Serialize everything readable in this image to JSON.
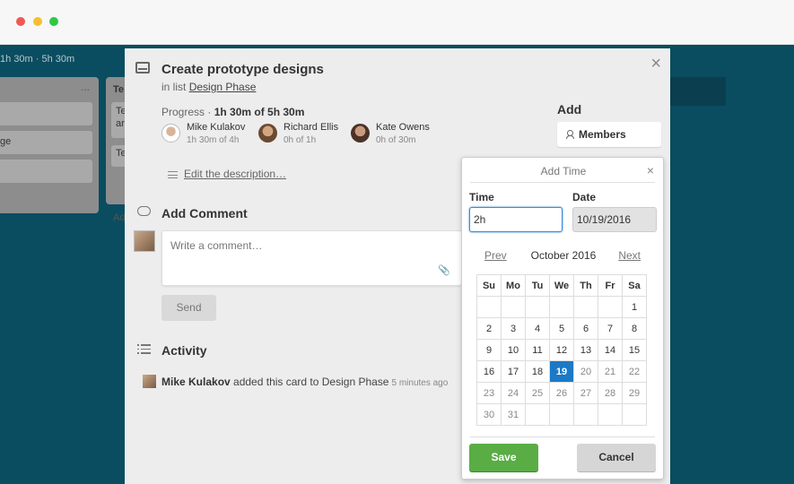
{
  "board": {
    "meta": "1h 30m · 5h 30m",
    "list1_cards": [
      "",
      "ge",
      ""
    ],
    "list1_more": "...",
    "list2_header": "Te",
    "list2_cards": [
      "Te\nar",
      "Te"
    ],
    "list2_add": "Ad"
  },
  "card": {
    "title": "Create prototype designs",
    "in_list_prefix": "in list",
    "list_name": "Design Phase",
    "progress_label": "Progress · ",
    "progress_value": "1h 30m of 5h 30m",
    "members": [
      {
        "name": "Mike Kulakov",
        "time": "1h 30m of 4h",
        "color": "#f2f2f2"
      },
      {
        "name": "Richard Ellis",
        "time": "0h of 1h",
        "color": "#8a5a3a"
      },
      {
        "name": "Kate Owens",
        "time": "0h of 30m",
        "color": "#5a3f33"
      }
    ],
    "edit_description": "Edit the description…",
    "add_comment_title": "Add Comment",
    "comment_placeholder": "Write a comment…",
    "send_label": "Send",
    "activity_title": "Activity",
    "activity": {
      "user": "Mike Kulakov",
      "text": " added this card to Design Phase",
      "ago": "5 minutes ago"
    },
    "close": "×"
  },
  "sidebar": {
    "add_heading": "Add",
    "members_label": "Members"
  },
  "add_time": {
    "title": "Add Time",
    "close": "×",
    "time_label": "Time",
    "time_value": "2h",
    "date_label": "Date",
    "date_value": "10/19/2016",
    "prev": "Prev",
    "month": "October 2016",
    "next": "Next",
    "weekdays": [
      "Su",
      "Mo",
      "Tu",
      "We",
      "Th",
      "Fr",
      "Sa"
    ],
    "weeks": [
      [
        "",
        "",
        "",
        "",
        "",
        "",
        "1"
      ],
      [
        "2",
        "3",
        "4",
        "5",
        "6",
        "7",
        "8"
      ],
      [
        "9",
        "10",
        "11",
        "12",
        "13",
        "14",
        "15"
      ],
      [
        "16",
        "17",
        "18",
        "19",
        "20",
        "21",
        "22"
      ],
      [
        "23",
        "24",
        "25",
        "26",
        "27",
        "28",
        "29"
      ],
      [
        "30",
        "31",
        "",
        "",
        "",
        "",
        ""
      ]
    ],
    "selected_day": "19",
    "save_label": "Save",
    "cancel_label": "Cancel"
  },
  "colors": {
    "board": "#0a4d60",
    "save": "#5aac44",
    "selected_day": "#1b79c6"
  }
}
